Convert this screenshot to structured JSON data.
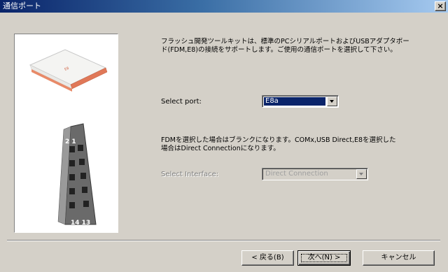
{
  "window": {
    "title": "通信ポート",
    "close_glyph": "×"
  },
  "description_1": {
    "line1": "フラッシュ開発ツールキットは、標準のPCシリアルポートおよびUSBアダプタボー",
    "line2": "ド(FDM,E8)の接続をサポートします。ご使用の通信ポートを選択して下さい。"
  },
  "port": {
    "label": "Select port:",
    "value": "E8a"
  },
  "description_2": {
    "line1": "FDMを選択した場合はブランクになります。COMx,USB Direct,E8を選択した",
    "line2": "場合はDirect Connectionになります。"
  },
  "interface": {
    "label": "Select Interface:",
    "value": "Direct Connection"
  },
  "image": {
    "pin_top": "2 1",
    "pin_bottom": "14 13",
    "device_text": "E8"
  },
  "buttons": {
    "back": "< 戻る(B)",
    "next": "次へ(N) >",
    "cancel": "キャンセル"
  }
}
